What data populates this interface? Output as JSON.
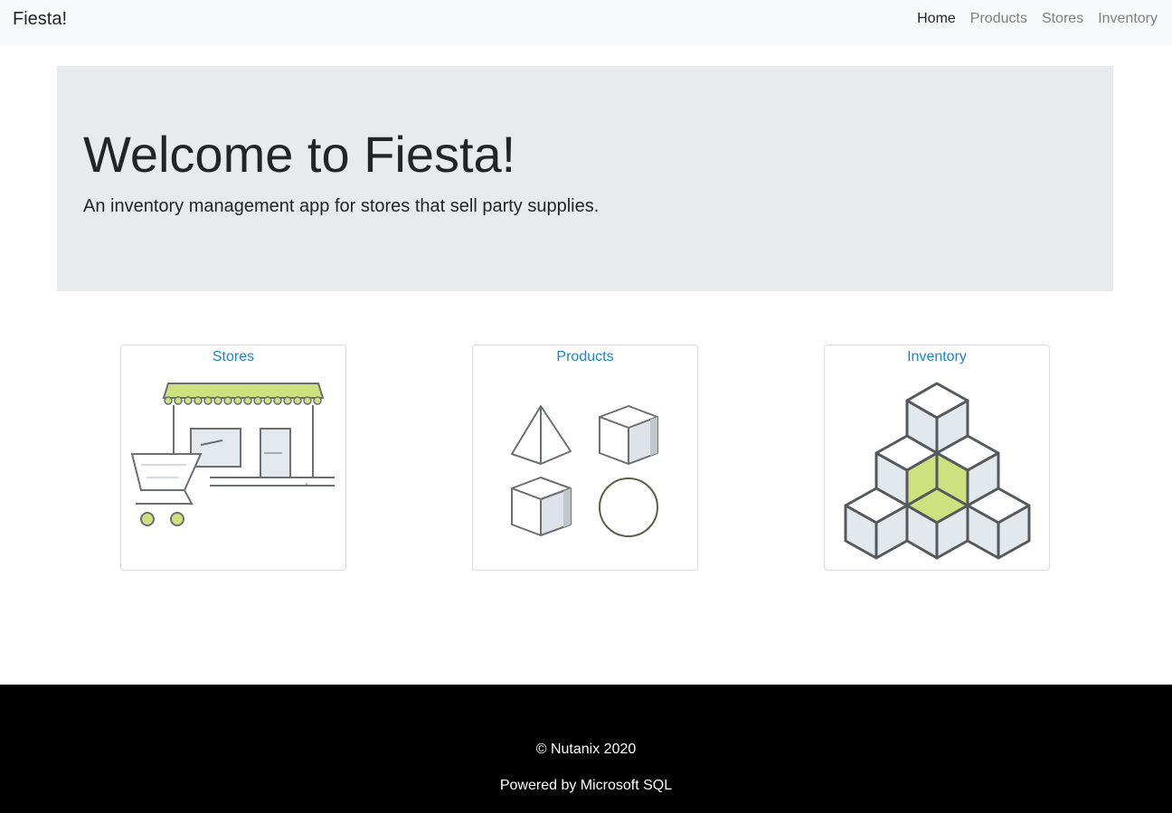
{
  "navbar": {
    "brand": "Fiesta!",
    "links": [
      {
        "label": "Home",
        "active": true
      },
      {
        "label": "Products",
        "active": false
      },
      {
        "label": "Stores",
        "active": false
      },
      {
        "label": "Inventory",
        "active": false
      }
    ]
  },
  "hero": {
    "title": "Welcome to Fiesta!",
    "lead": "An inventory management app for stores that sell party supplies."
  },
  "cards": [
    {
      "label": "Stores",
      "icon": "store-icon"
    },
    {
      "label": "Products",
      "icon": "products-icon"
    },
    {
      "label": "Inventory",
      "icon": "inventory-icon"
    }
  ],
  "footer": {
    "copyright": "© Nutanix 2020",
    "powered_by": "Powered by Microsoft SQL"
  },
  "colors": {
    "accent": "#cfe07e",
    "link": "#1a82d8",
    "navbar_bg": "#f8f9fa",
    "hero_bg": "#e7ebee",
    "footer_bg": "#000000"
  }
}
